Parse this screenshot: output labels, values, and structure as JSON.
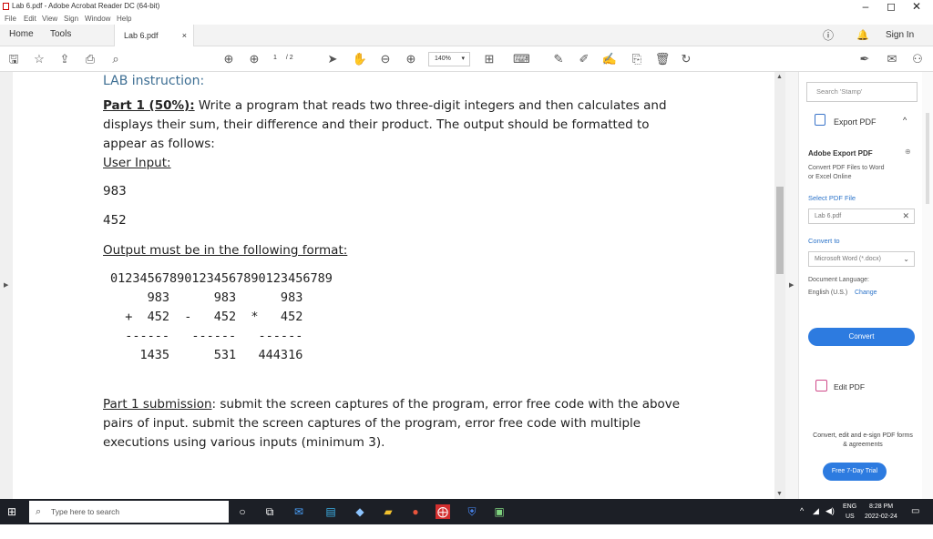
{
  "window": {
    "title": "Lab 6.pdf - Adobe Acrobat Reader DC (64-bit)",
    "minimize": "–",
    "maximize": "◻",
    "close": "✕"
  },
  "menu": [
    "File",
    "Edit",
    "View",
    "Sign",
    "Window",
    "Help"
  ],
  "tabs": {
    "home": "Home",
    "tools": "Tools",
    "doc": "Lab 6.pdf",
    "doc_close": "×",
    "sign_in": "Sign In"
  },
  "toolbar": {
    "page_current": "1",
    "page_total": "/ 2",
    "zoom": "140%"
  },
  "document": {
    "heading": "LAB instruction:",
    "part1_title": "Part 1 (50%):",
    "part1_text_1": " Write a program that reads two three-digit integers and then calculates and",
    "part1_text_2": "displays their sum, their difference and their product. The output should be formatted to",
    "part1_text_3": "appear as follows:",
    "user_input_label": "User Input:",
    "input_1": "983",
    "input_2": "452",
    "output_label": "Output must be in the following format:",
    "ruler": "012345678901234567890123456789",
    "row1": "     983      983      983",
    "row2": "  +  452  -   452  *   452",
    "row3": "  ------   ------   ------",
    "row4": "    1435      531   444316",
    "submission_title": "Part 1 submission",
    "submission_text_1": ": submit the screen captures of the program, error free code with the above",
    "submission_text_2": "pairs of input. submit the screen captures of the program, error free code with multiple",
    "submission_text_3": "executions using various inputs (minimum 3)."
  },
  "side_panel": {
    "search_placeholder": "Search 'Stamp'",
    "export_pdf": "Export PDF",
    "adobe_export_pdf": "Adobe Export PDF",
    "convert_desc": "Convert PDF Files to Word or Excel Online",
    "select_pdf_file": "Select PDF File",
    "file_name": "Lab 6.pdf",
    "convert_to": "Convert to",
    "format": "Microsoft Word (*.docx)",
    "doc_language_label": "Document Language:",
    "doc_language_value": "English (U.S.)",
    "change": "Change",
    "convert_button": "Convert",
    "edit_pdf": "Edit PDF",
    "promo_text": "Convert, edit and e-sign PDF forms & agreements",
    "trial_button": "Free 7-Day Trial"
  },
  "taskbar": {
    "search_placeholder": "Type here to search",
    "lang_1": "ENG",
    "lang_2": "US",
    "time": "8:28 PM",
    "date": "2022-02-24"
  }
}
